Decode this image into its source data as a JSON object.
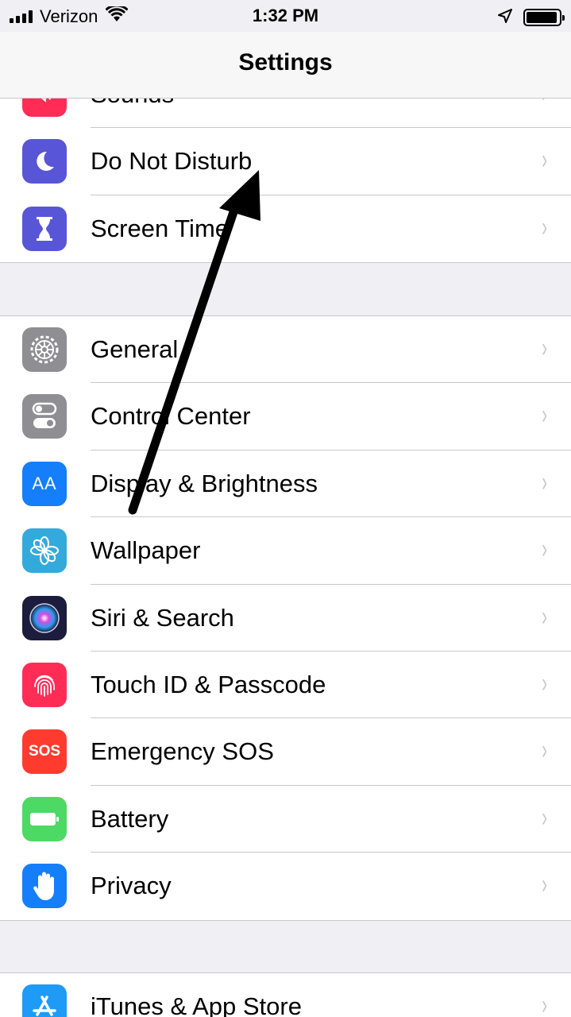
{
  "status_bar": {
    "carrier": "Verizon",
    "time": "1:32 PM",
    "signal_bars": 4,
    "wifi_icon": "wifi-icon",
    "location_icon": "location-arrow-icon",
    "battery_level": 0.95
  },
  "nav": {
    "title": "Settings"
  },
  "group1": [
    {
      "label": "Sounds",
      "icon": "speaker-icon",
      "color": "#ff2d55"
    },
    {
      "label": "Do Not Disturb",
      "icon": "moon-icon",
      "color": "#5856d6"
    },
    {
      "label": "Screen Time",
      "icon": "hourglass-icon",
      "color": "#5856d6"
    }
  ],
  "group2": [
    {
      "label": "General",
      "icon": "gear-icon",
      "color": "#8e8e93"
    },
    {
      "label": "Control Center",
      "icon": "toggle-icon",
      "color": "#8e8e93"
    },
    {
      "label": "Display & Brightness",
      "icon": "text-size-icon",
      "color": "#147efb"
    },
    {
      "label": "Wallpaper",
      "icon": "flower-icon",
      "color": "#34aadc"
    },
    {
      "label": "Siri & Search",
      "icon": "siri-icon",
      "color": "#1c1c3c"
    },
    {
      "label": "Touch ID & Passcode",
      "icon": "fingerprint-icon",
      "color": "#ff2d55"
    },
    {
      "label": "Emergency SOS",
      "icon": "sos-icon",
      "color": "#ff3b30"
    },
    {
      "label": "Battery",
      "icon": "battery-icon",
      "color": "#4cd964"
    },
    {
      "label": "Privacy",
      "icon": "hand-icon",
      "color": "#147efb"
    }
  ],
  "group3": [
    {
      "label": "iTunes & App Store",
      "icon": "app-store-icon",
      "color": "#1d9bf6"
    }
  ],
  "icon_text": {
    "sos": "SOS",
    "text_size": "AA"
  },
  "chevron": "›",
  "annotation": {
    "arrow_color": "#000000"
  }
}
